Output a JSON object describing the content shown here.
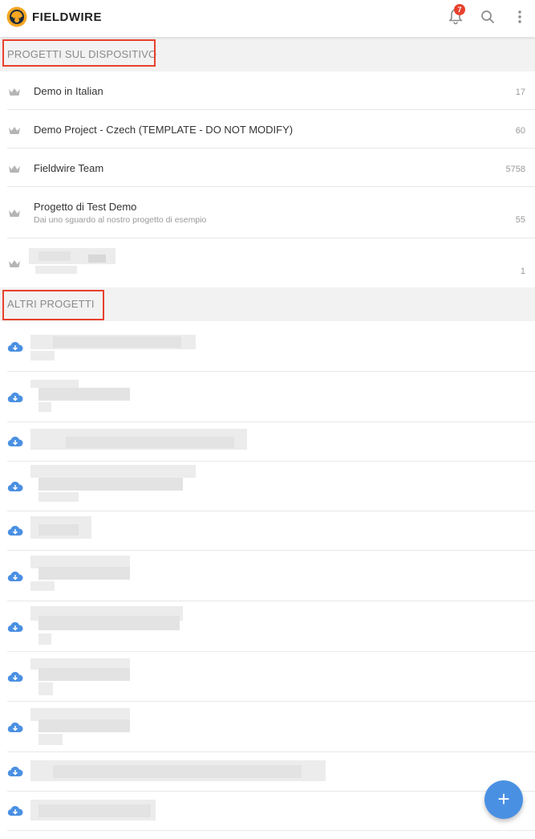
{
  "app": {
    "brand": "FIELDWIRE",
    "notification_count": "7",
    "icons": [
      "fieldwire-logo-icon",
      "bell-icon",
      "search-icon",
      "more-vert-icon"
    ]
  },
  "sections": {
    "device": "PROGETTI SUL DISPOSITIVO",
    "other": "ALTRI PROGETTI"
  },
  "device_projects": [
    {
      "title": "Demo in Italian",
      "subtitle": "",
      "count": "17"
    },
    {
      "title": "Demo Project - Czech (TEMPLATE - DO NOT MODIFY)",
      "subtitle": "",
      "count": "60"
    },
    {
      "title": "Fieldwire Team",
      "subtitle": "",
      "count": "5758"
    },
    {
      "title": "Progetto di Test Demo",
      "subtitle": "Dai uno sguardo al nostro progetto di esempio",
      "count": "55"
    },
    {
      "title": "",
      "subtitle": "",
      "count": "1"
    }
  ],
  "fab_label": "+",
  "colors": {
    "accent": "#4a90e2",
    "highlight": "#e8412d",
    "section_bg": "#f2f2f2"
  }
}
